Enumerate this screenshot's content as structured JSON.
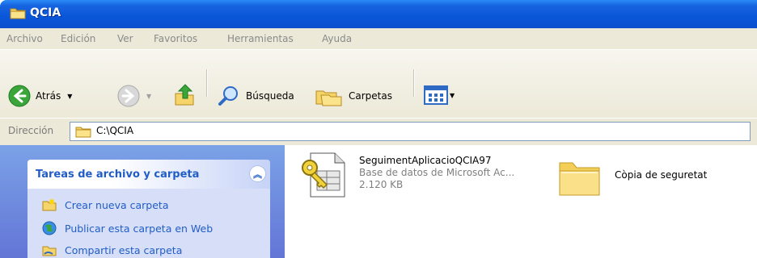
{
  "window": {
    "title": "QCIA"
  },
  "menu": [
    "Archivo",
    "Edición",
    "Ver",
    "Favoritos",
    "Herramientas",
    "Ayuda"
  ],
  "toolbar": {
    "back_label": "Atrás",
    "search_label": "Búsqueda",
    "folders_label": "Carpetas"
  },
  "address": {
    "label": "Dirección",
    "path": "C:\\QCIA"
  },
  "tasks": {
    "title": "Tareas de archivo y carpeta",
    "items": [
      "Crear nueva carpeta",
      "Publicar esta carpeta en Web",
      "Compartir esta carpeta"
    ]
  },
  "files": [
    {
      "name": "SeguimentAplicacioQCIA97",
      "type": "Base de datos de Microsoft Ac...",
      "size": "2.120 KB",
      "icon": "access-database-icon"
    },
    {
      "name": "Còpia de seguretat",
      "icon": "folder-icon"
    }
  ]
}
